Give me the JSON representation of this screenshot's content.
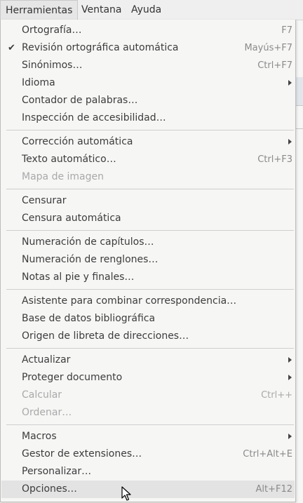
{
  "menubar": {
    "items": [
      {
        "label": "Herramientas"
      },
      {
        "label": "Ventana"
      },
      {
        "label": "Ayuda"
      }
    ]
  },
  "menu": {
    "items": [
      {
        "label": "Ortografía…",
        "shortcut": "F7"
      },
      {
        "label": "Revisión ortográfica automática",
        "shortcut": "Mayús+F7",
        "checked": true
      },
      {
        "label": "Sinónimos…",
        "shortcut": "Ctrl+F7"
      },
      {
        "label": "Idioma",
        "shortcut": ""
      },
      {
        "label": "Contador de palabras…",
        "shortcut": ""
      },
      {
        "label": "Inspección de accesibilidad…",
        "shortcut": ""
      },
      {
        "label": "Corrección automática",
        "shortcut": ""
      },
      {
        "label": "Texto automático…",
        "shortcut": "Ctrl+F3"
      },
      {
        "label": "Mapa de imagen",
        "shortcut": ""
      },
      {
        "label": "Censurar",
        "shortcut": ""
      },
      {
        "label": "Censura automática",
        "shortcut": ""
      },
      {
        "label": "Numeración de capítulos…",
        "shortcut": ""
      },
      {
        "label": "Numeración de renglones…",
        "shortcut": ""
      },
      {
        "label": "Notas al pie y finales…",
        "shortcut": ""
      },
      {
        "label": "Asistente para combinar correspondencia…",
        "shortcut": ""
      },
      {
        "label": "Base de datos bibliográfica",
        "shortcut": ""
      },
      {
        "label": "Origen de libreta de direcciones…",
        "shortcut": ""
      },
      {
        "label": "Actualizar",
        "shortcut": ""
      },
      {
        "label": "Proteger documento",
        "shortcut": ""
      },
      {
        "label": "Calcular",
        "shortcut": "Ctrl++"
      },
      {
        "label": "Ordenar…",
        "shortcut": ""
      },
      {
        "label": "Macros",
        "shortcut": ""
      },
      {
        "label": "Gestor de extensiones…",
        "shortcut": "Ctrl+Alt+E"
      },
      {
        "label": "Personalizar…",
        "shortcut": ""
      },
      {
        "label": "Opciones…",
        "shortcut": "Alt+F12"
      }
    ]
  },
  "icons": {
    "check": "check-icon",
    "submenu": "submenu-arrow-icon",
    "cursor": "mouse-pointer-icon"
  }
}
